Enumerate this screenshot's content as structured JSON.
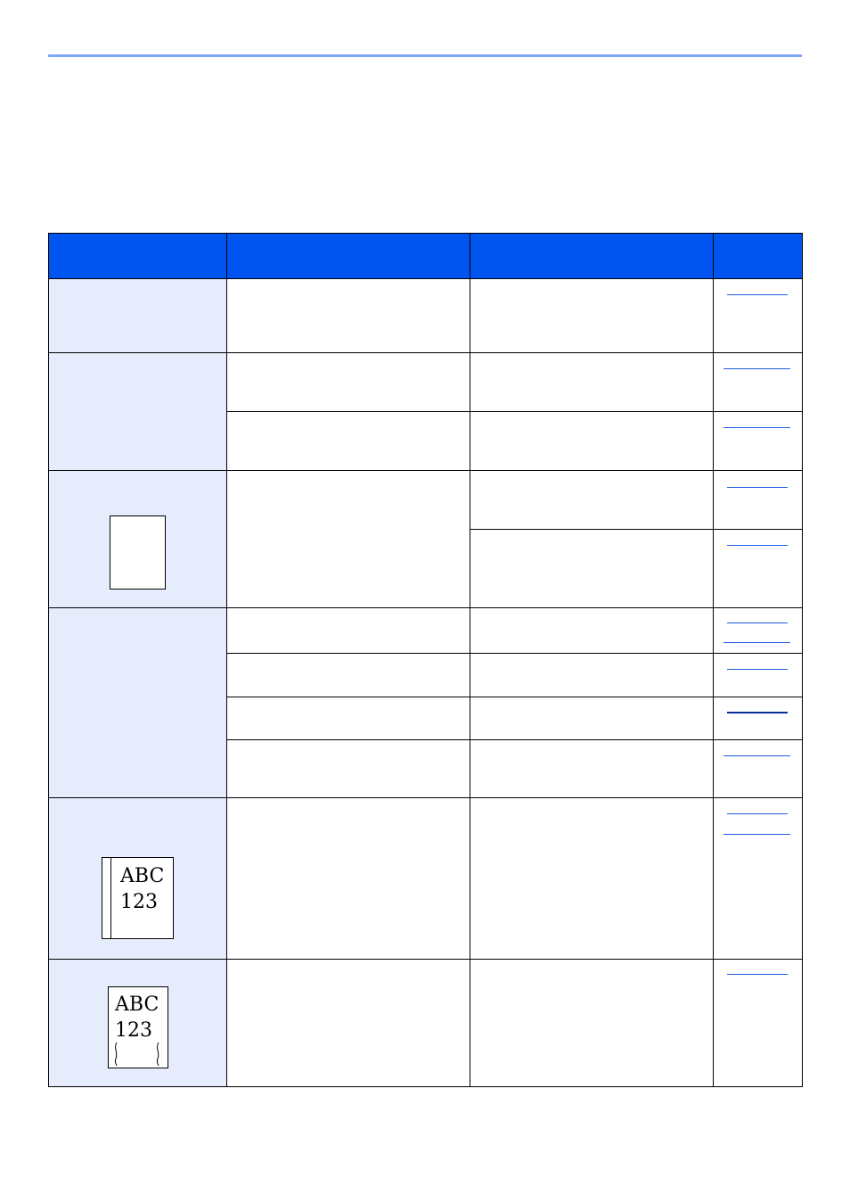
{
  "page": {
    "heading": "",
    "accent_color": "#7ea6f5"
  },
  "table": {
    "header_color": "#0055f0",
    "symptom_color": "#e6ecfb",
    "link_color": "#1e5ee6",
    "headers": [
      "",
      "",
      "",
      ""
    ]
  },
  "samples": {
    "bound_text_line1": "ABC",
    "bound_text_line2": "123",
    "curl_text_line1": "ABC",
    "curl_text_line2": "123"
  }
}
